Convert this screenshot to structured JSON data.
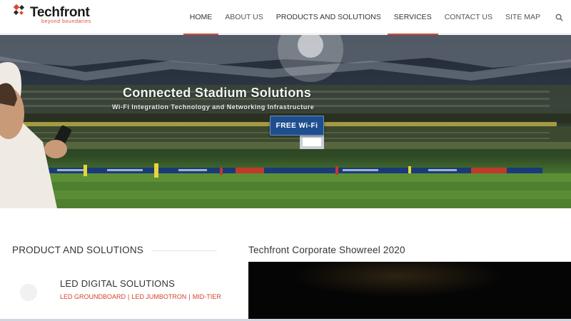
{
  "brand": {
    "name": "Techfront",
    "tagline": "beyond boundaries",
    "accent_color": "#d44a3a"
  },
  "nav": {
    "items": [
      {
        "label": "HOME",
        "active": true
      },
      {
        "label": "ABOUT US",
        "active": false
      },
      {
        "label": "PRODUCTS AND SOLUTIONS",
        "active": false
      },
      {
        "label": "SERVICES",
        "active": true
      },
      {
        "label": "CONTACT US",
        "active": false
      },
      {
        "label": "SITE MAP",
        "active": false
      }
    ],
    "search_icon": "search-icon"
  },
  "hero": {
    "title": "Connected Stadium Solutions",
    "subtitle": "Wi-Fi Integration Technology and Networking Infrastructure",
    "button_label": "FREE Wi-Fi"
  },
  "products": {
    "heading": "PRODUCT AND SOLUTIONS",
    "item": {
      "title": "LED DIGITAL SOLUTIONS",
      "links": [
        "LED GROUNDBOARD",
        "LED JUMBOTRON",
        "MID-TIER"
      ]
    }
  },
  "showreel": {
    "heading": "Techfront Corporate Showreel 2020"
  }
}
